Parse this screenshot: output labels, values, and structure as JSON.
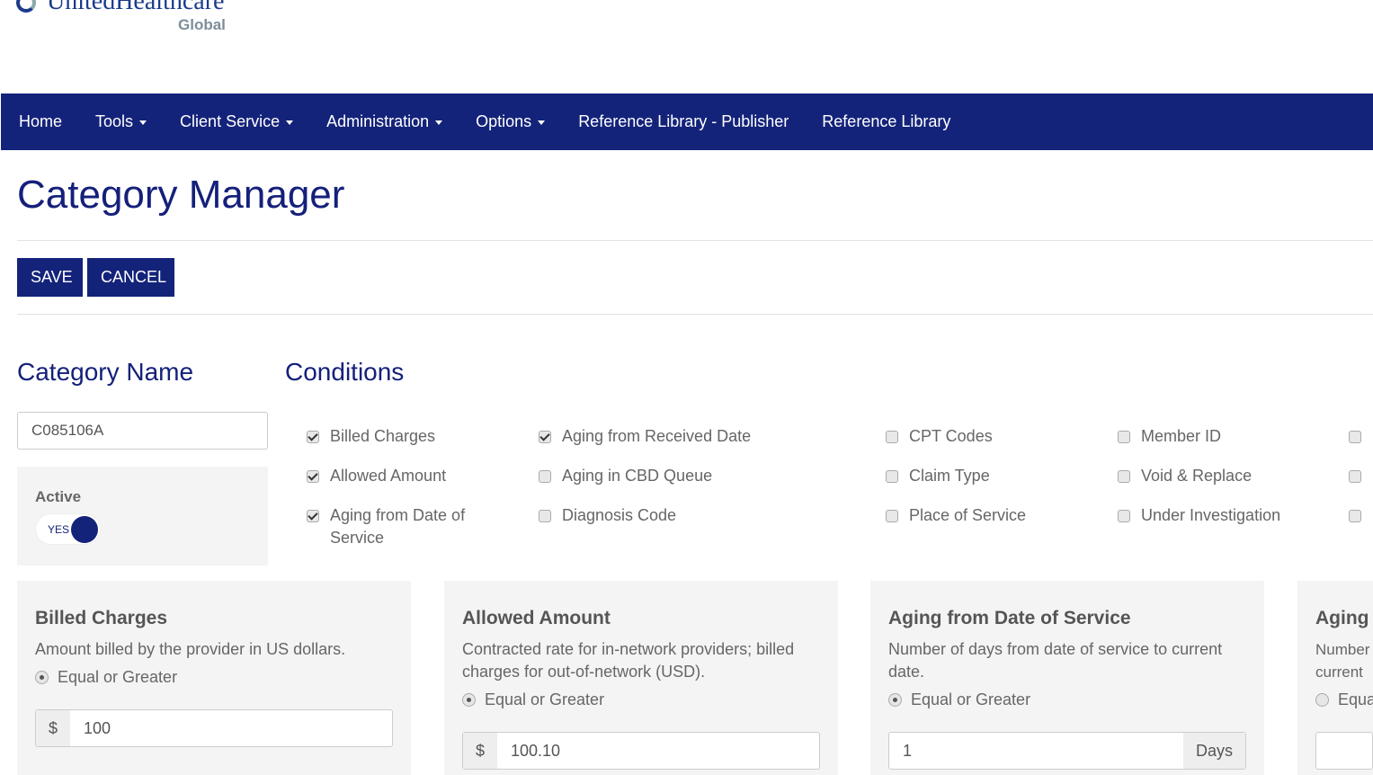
{
  "logo": {
    "brand": "UnitedHealthcare",
    "sub": "Global"
  },
  "nav": [
    {
      "label": "Home"
    },
    {
      "label": "Tools",
      "dropdown": true
    },
    {
      "label": "Client Service",
      "dropdown": true
    },
    {
      "label": "Administration",
      "dropdown": true
    },
    {
      "label": "Options",
      "dropdown": true
    },
    {
      "label": "Reference Library - Publisher"
    },
    {
      "label": "Reference Library"
    }
  ],
  "page_title": "Category Manager",
  "buttons": {
    "save": "SAVE",
    "cancel": "CANCEL"
  },
  "category": {
    "heading": "Category Name",
    "value": "C085106A",
    "active_label": "Active",
    "toggle_label": "YES"
  },
  "conditions": {
    "heading": "Conditions",
    "items": [
      {
        "label": "Billed Charges",
        "checked": true
      },
      {
        "label": "Allowed Amount",
        "checked": true
      },
      {
        "label": "Aging from Date of Service",
        "checked": true
      },
      {
        "label": "Aging from Received Date",
        "checked": true
      },
      {
        "label": "Aging in CBD Queue",
        "checked": false
      },
      {
        "label": "Diagnosis Code",
        "checked": false
      },
      {
        "label": "CPT Codes",
        "checked": false
      },
      {
        "label": "Claim Type",
        "checked": false
      },
      {
        "label": "Place of Service",
        "checked": false
      },
      {
        "label": "Member ID",
        "checked": false
      },
      {
        "label": "Void & Replace",
        "checked": false
      },
      {
        "label": "Under Investigation",
        "checked": false
      },
      {
        "label": "",
        "checked": false
      },
      {
        "label": "",
        "checked": false
      },
      {
        "label": "",
        "checked": false
      }
    ]
  },
  "cards": [
    {
      "title": "Billed Charges",
      "desc": "Amount billed by the provider in US dollars.",
      "option": "Equal or Greater",
      "prefix": "$",
      "value": "100",
      "suffix": ""
    },
    {
      "title": "Allowed Amount",
      "desc": "Contracted rate for in-network providers; billed charges for out-of-network (USD).",
      "option": "Equal or Greater",
      "prefix": "$",
      "value": "100.10",
      "suffix": ""
    },
    {
      "title": "Aging from Date of Service",
      "desc": "Number of days from date of service to current date.",
      "option": "Equal or Greater",
      "prefix": "",
      "value": "1",
      "suffix": "Days"
    },
    {
      "title": "Aging",
      "desc": "Number current",
      "option": "Equa",
      "prefix": "",
      "value": "",
      "suffix": ""
    }
  ]
}
